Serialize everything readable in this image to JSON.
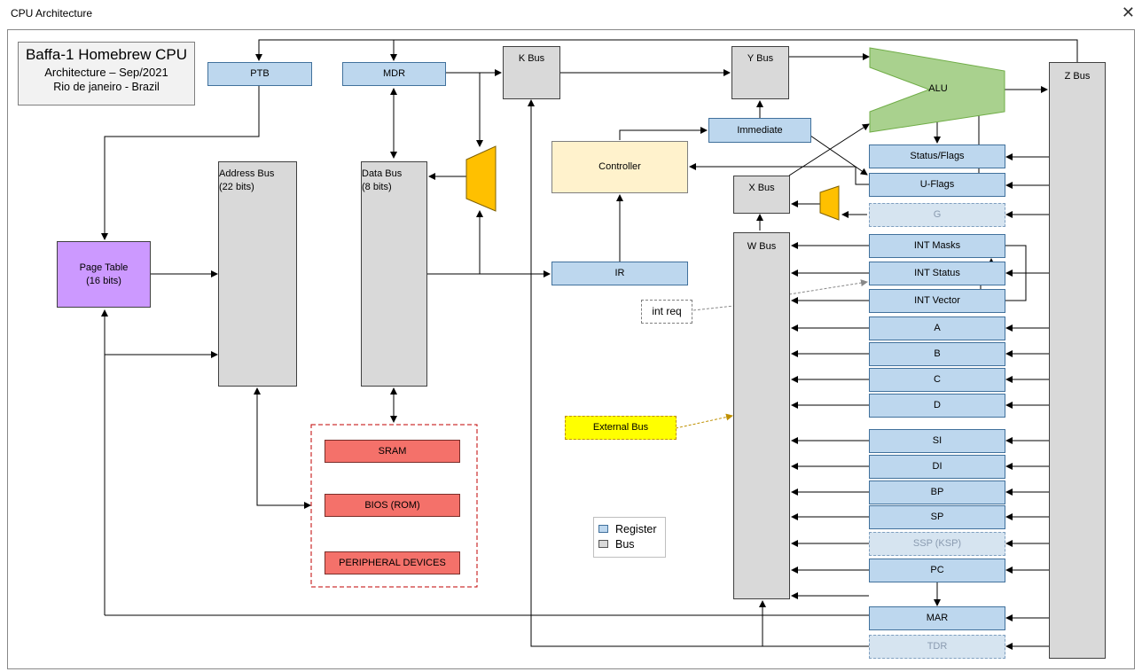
{
  "window": {
    "title": "CPU Architecture",
    "close_icon": "close-icon"
  },
  "info": {
    "line1": "Baffa-1 Homebrew CPU",
    "line2": "Architecture – Sep/2021",
    "line3": "Rio de janeiro - Brazil"
  },
  "registers": {
    "ptb": "PTB",
    "mdr": "MDR",
    "immediate": "Immediate",
    "ir": "IR",
    "status_flags": "Status/Flags",
    "u_flags": "U-Flags",
    "g": "G",
    "int_masks": "INT Masks",
    "int_status": "INT Status",
    "int_vector": "INT Vector",
    "a": "A",
    "b": "B",
    "c": "C",
    "d": "D",
    "si": "SI",
    "di": "DI",
    "bp": "BP",
    "sp": "SP",
    "ssp": "SSP (KSP)",
    "pc": "PC",
    "mar": "MAR",
    "tdr": "TDR"
  },
  "buses": {
    "k": "K Bus",
    "y": "Y Bus",
    "z": "Z Bus",
    "x": "X Bus",
    "w": "W Bus",
    "address_l1": "Address Bus",
    "address_l2": "(22 bits)",
    "data_l1": "Data Bus",
    "data_l2": "(8 bits)"
  },
  "blocks": {
    "alu": "ALU",
    "controller": "Controller",
    "page_table_l1": "Page Table",
    "page_table_l2": "(16 bits)",
    "int_req": "int req",
    "external_bus": "External Bus"
  },
  "memory": {
    "sram": "SRAM",
    "bios": "BIOS (ROM)",
    "peripheral": "PERIPHERAL  DEVICES"
  },
  "legend": {
    "register": "Register",
    "bus": "Bus"
  },
  "colors": {
    "register": "#bdd7ee",
    "bus": "#d9d9d9",
    "alu": "#a9d18e",
    "controller": "#fff2cc",
    "page_table": "#cc99ff",
    "memory": "#f4716a",
    "mux": "#ffc000",
    "external": "#ffff00"
  }
}
